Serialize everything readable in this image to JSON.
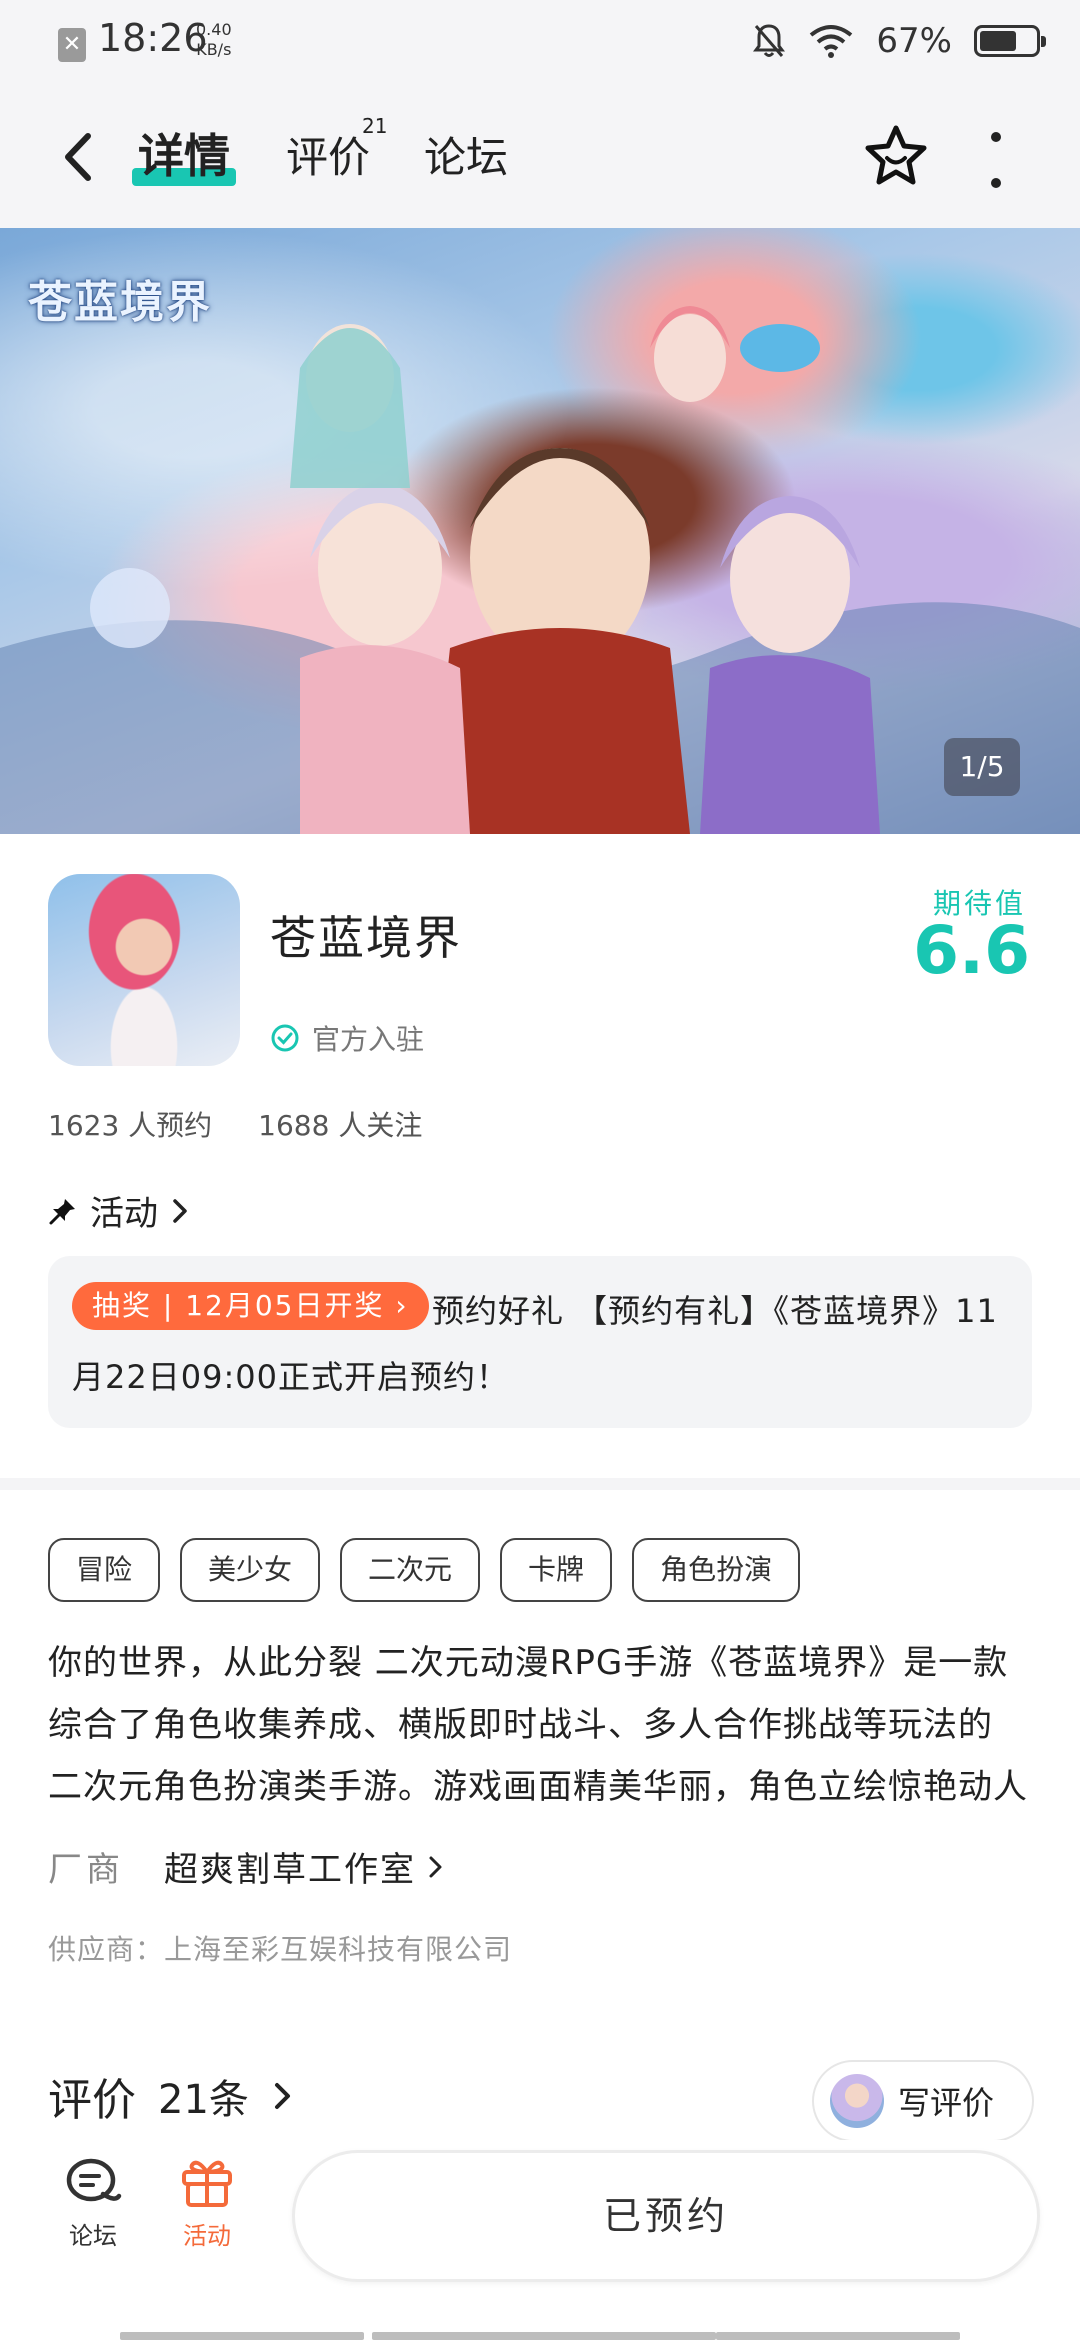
{
  "status_bar": {
    "time": "18:26",
    "speed_value": "0.40",
    "speed_unit": "KB/s",
    "battery_percent": "67%",
    "battery_level": 0.67
  },
  "header": {
    "tabs": [
      {
        "label": "详情",
        "active": true
      },
      {
        "label": "评价",
        "badge": "21",
        "active": false
      },
      {
        "label": "论坛",
        "active": false
      }
    ]
  },
  "banner": {
    "logo_text": "苍蓝境界",
    "counter": "1/5"
  },
  "app": {
    "name": "苍蓝境界",
    "verified_label": "官方入驻",
    "expect_label": "期待值",
    "expect_value": "6.6",
    "reservations": "1623 人预约",
    "followers": "1688 人关注"
  },
  "activity": {
    "heading": "活动",
    "badge": "抽奖 | 12月05日开奖 ›",
    "text": "预约好礼 【预约有礼】《苍蓝境界》11月22日09:00正式开启预约！"
  },
  "tags": [
    "冒险",
    "美少女",
    "二次元",
    "卡牌",
    "角色扮演"
  ],
  "description": {
    "line1": "你的世界，从此分裂 二次元动漫RPG手游《苍蓝境界》是一款",
    "line2": "综合了角色收集养成、横版即时战斗、多人合作挑战等玩法的",
    "line3": "二次元角色扮演类手游。游戏画面精美华丽，角色立绘惊艳动人"
  },
  "vendor": {
    "label": "厂商",
    "name": "超爽割草工作室"
  },
  "supplier": "供应商：上海至彩互娱科技有限公司",
  "reviews": {
    "title": "评价",
    "count": "21条",
    "write_label": "写评价"
  },
  "bottom_nav": {
    "forum_label": "论坛",
    "activity_label": "活动",
    "reserve_label": "已预约"
  },
  "colors": {
    "accent": "#19c6b2",
    "orange": "#ff6a3d",
    "activity_nav": "#f46a3a"
  }
}
